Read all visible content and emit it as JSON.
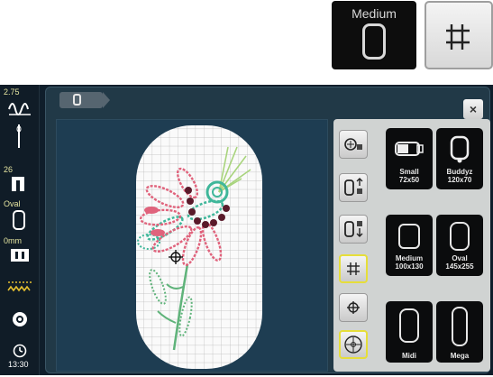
{
  "header": {
    "hoop_label": "Medium",
    "hoop_icon": "hoop-outline-icon",
    "grid_icon": "grid-icon"
  },
  "left_bar": {
    "stitch_width": "2.75",
    "presser_foot": "26",
    "hoop_type": "Oval",
    "thread_size": "0mm",
    "time": "13:30"
  },
  "panel": {
    "hoop_tab_icon": "hoop-outline-icon",
    "close_label": "×"
  },
  "hoops": [
    {
      "name": "Small",
      "size": "72x50"
    },
    {
      "name": "Buddyz",
      "size": "120x70"
    },
    {
      "name": "Medium",
      "size": "100x130"
    },
    {
      "name": "Oval",
      "size": "145x255"
    },
    {
      "name": "Midi",
      "size": ""
    },
    {
      "name": "Mega",
      "size": ""
    }
  ],
  "colors": {
    "screen_bg": "#0f1e2b",
    "panel_bg": "#213947",
    "active_border": "#e6de3a",
    "petal_pink": "#e0637c",
    "leaf_green": "#5fb37a",
    "bead_dark": "#5a1a2a"
  }
}
